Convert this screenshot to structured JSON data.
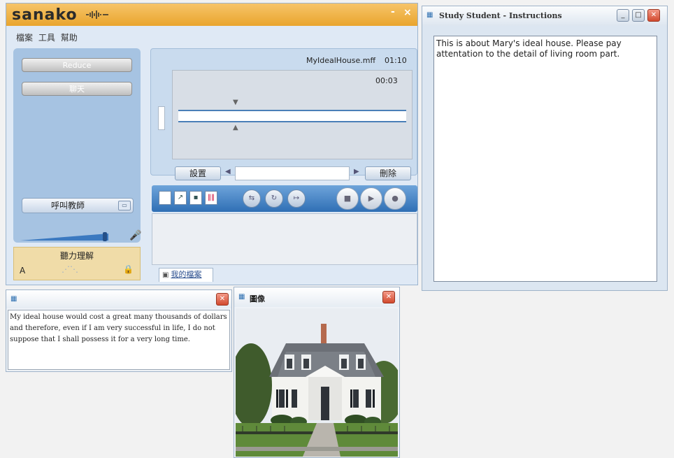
{
  "sanako": {
    "logo": "sanako",
    "title_minimize": "-",
    "title_close": "×",
    "menu": [
      "檔案",
      "工具",
      "幫助"
    ],
    "left_buttons": {
      "reduce": "Reduce",
      "chat": "聊天"
    },
    "call_teacher": "呼叫教師",
    "volume_level": 0.9,
    "listening": {
      "title": "聽力理解",
      "grade": "A"
    },
    "recorder": {
      "file_name": "MyIdealHouse.mff",
      "file_duration": "01:10",
      "position": "00:03",
      "settings_label": "設置",
      "delete_label": "刪除",
      "note_value": ""
    },
    "tab_my_files": "我的檔案"
  },
  "instructions_window": {
    "title": "Study Student - Instructions",
    "text": "This is about Mary's ideal house. Please pay attentation to the detail of living room part."
  },
  "text_window": {
    "text": "My ideal house would cost a great many thousands of dollars and therefore, even if I am very successful in life, I do not suppose that I shall possess it for a very long time."
  },
  "image_window": {
    "title": "圖像"
  },
  "colors": {
    "sanako_title": "#e9a52d",
    "toolbar": "#2f6fb5",
    "close_button": "#d24a2e"
  }
}
